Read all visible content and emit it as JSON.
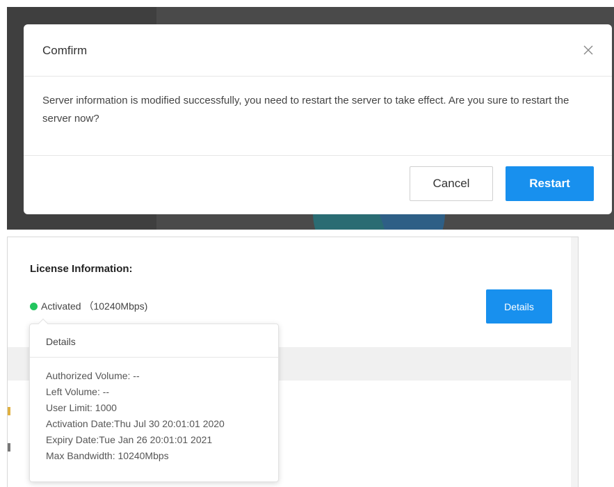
{
  "dialog": {
    "title": "Comfirm",
    "close_icon": "close-icon",
    "message": "Server information is modified successfully, you need to restart the server to take effect. Are you sure to restart the server now?",
    "cancel_label": "Cancel",
    "restart_label": "Restart"
  },
  "license": {
    "section_title": "License Information:",
    "status_text": "Activated （10240Mbps)",
    "status_color": "#22c55e",
    "details_button_label": "Details"
  },
  "popover": {
    "title": "Details",
    "items": [
      "Authorized Volume: --",
      "Left Volume: --",
      "User Limit: 1000",
      "Activation Date:Thu Jul 30 20:01:01 2020",
      "Expiry Date:Tue Jan 26 20:01:01 2021",
      "Max Bandwidth: 10240Mbps"
    ]
  },
  "colors": {
    "primary": "#1890ee",
    "overlay": "#4a4a4a"
  }
}
